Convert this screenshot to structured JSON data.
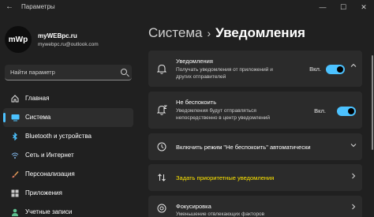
{
  "window": {
    "title": "Параметры",
    "back_glyph": "←",
    "controls": {
      "minimize": "—",
      "maximize": "☐",
      "close": "✕"
    }
  },
  "profile": {
    "avatar_text": "mWp",
    "name": "myWEBpc.ru",
    "email": "mywebpc.ru@outlook.com"
  },
  "search": {
    "placeholder": "Найти параметр"
  },
  "nav": {
    "items": [
      {
        "label": "Главная",
        "icon": "home-icon"
      },
      {
        "label": "Система",
        "icon": "monitor-icon",
        "active": true
      },
      {
        "label": "Bluetooth и устройства",
        "icon": "bluetooth-icon"
      },
      {
        "label": "Сеть и Интернет",
        "icon": "wifi-icon"
      },
      {
        "label": "Персонализация",
        "icon": "brush-icon"
      },
      {
        "label": "Приложения",
        "icon": "apps-icon"
      },
      {
        "label": "Учетные записи",
        "icon": "user-icon"
      }
    ]
  },
  "breadcrumb": {
    "parent": "Система",
    "separator": "›",
    "current": "Уведомления"
  },
  "cards": {
    "notifications": {
      "title": "Уведомления",
      "desc1": "Получать уведомления от приложений и",
      "desc2": "других отправителей",
      "toggle_label": "Вкл.",
      "toggle_on": true
    },
    "dnd": {
      "title": "Не беспокоить",
      "desc1": "Уведомления будут отправляться",
      "desc2": "непосредственно в центр уведомлений",
      "toggle_label": "Вкл.",
      "toggle_on": true
    },
    "auto_dnd": {
      "title": "Включить режим \"Не беспокоить\" автоматически"
    },
    "priority": {
      "title": "Задать приоритетные уведомления"
    },
    "focus": {
      "title": "Фокусировка",
      "desc": "Уменьшение отвлекающих факторов"
    }
  },
  "colors": {
    "background": "#202020",
    "card": "#2b2b2b",
    "accent": "#4cc2ff",
    "highlight": "#ffe600"
  }
}
